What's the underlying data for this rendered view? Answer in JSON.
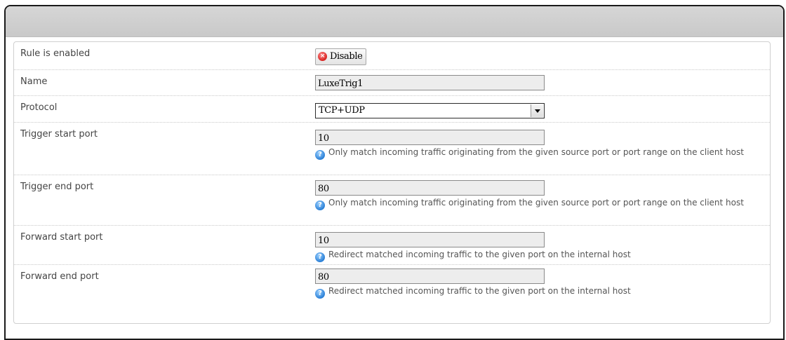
{
  "form": {
    "rows": [
      {
        "label": "Rule is enabled",
        "button": {
          "label": "Disable",
          "icon": "disable-x-icon"
        }
      },
      {
        "label": "Name",
        "value": "LuxeTrig1"
      },
      {
        "label": "Protocol",
        "selected": "TCP+UDP"
      },
      {
        "label": "Trigger start port",
        "value": "10",
        "hint": "Only match incoming traffic originating from the given source port or port range on the client host"
      },
      {
        "label": "Trigger end port",
        "value": "80",
        "hint": "Only match incoming traffic originating from the given source port or port range on the client host"
      },
      {
        "label": "Forward start port",
        "value": "10",
        "hint": "Redirect matched incoming traffic to the given port on the internal host"
      },
      {
        "label": "Forward end port",
        "value": "80",
        "hint": "Redirect matched incoming traffic to the given port on the internal host"
      }
    ]
  },
  "colors": {
    "title_bar": "#cccccc",
    "disable_icon": "#d8211f",
    "help_icon": "#2a7fd6"
  }
}
